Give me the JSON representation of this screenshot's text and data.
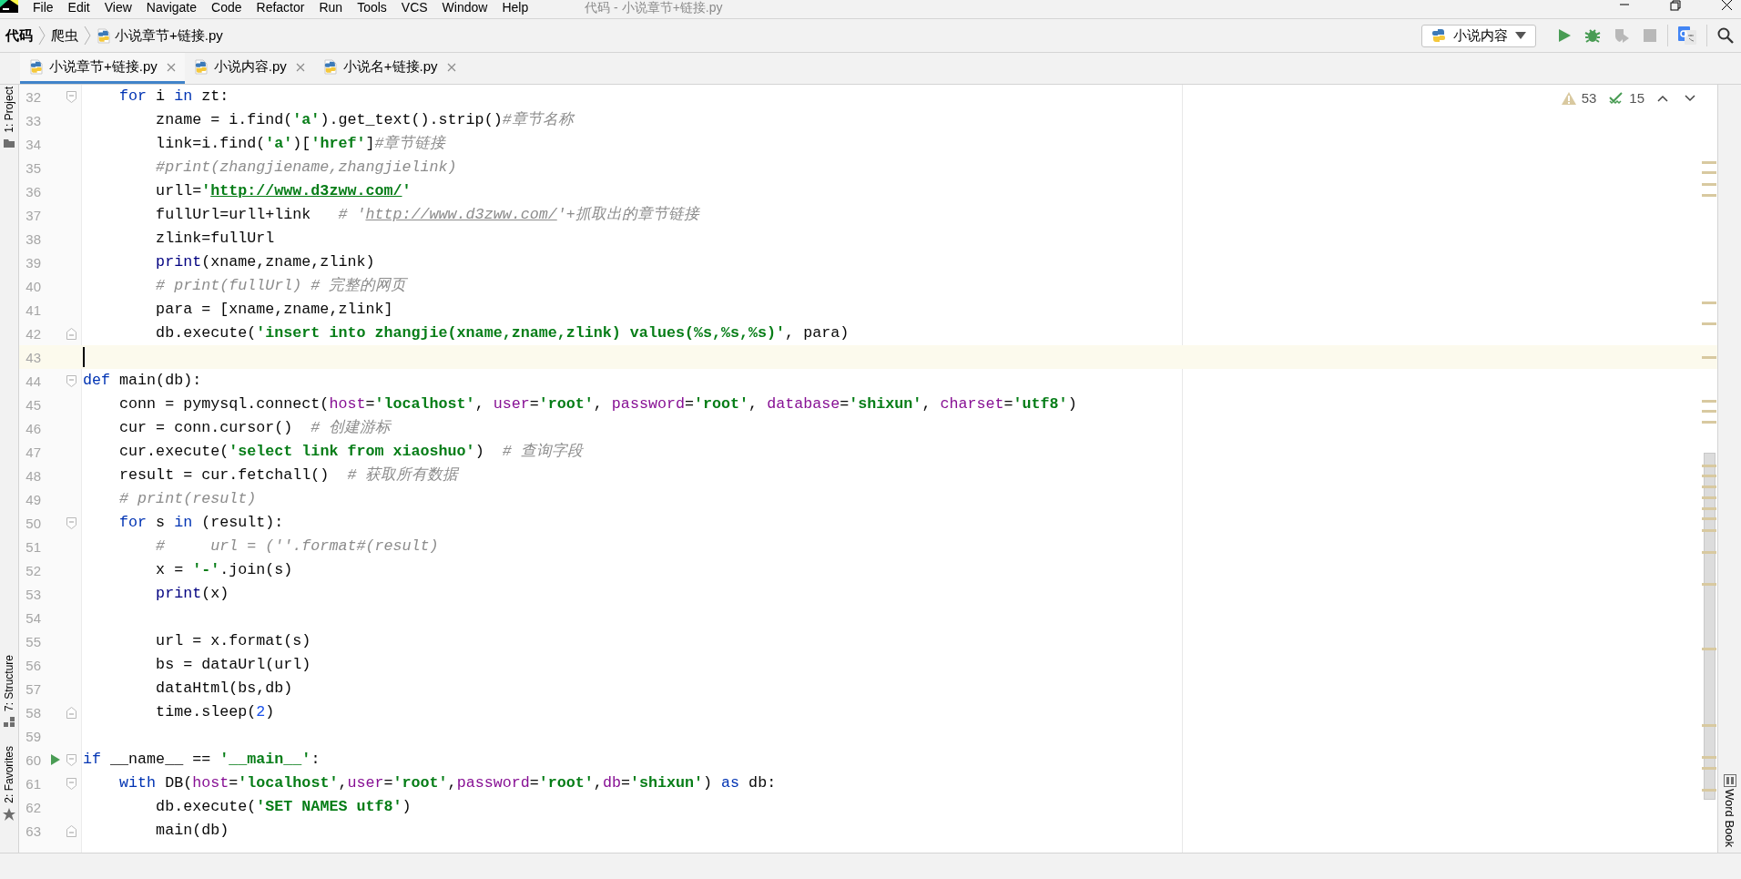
{
  "window": {
    "title": "代码 - 小说章节+链接.py"
  },
  "menu": [
    "File",
    "Edit",
    "View",
    "Navigate",
    "Code",
    "Refactor",
    "Run",
    "Tools",
    "VCS",
    "Window",
    "Help"
  ],
  "breadcrumb": [
    {
      "kind": "project",
      "text": "代码"
    },
    {
      "kind": "folder",
      "text": "爬虫"
    },
    {
      "kind": "file",
      "text": "小说章节+链接.py"
    }
  ],
  "run_config": {
    "label": "小说内容"
  },
  "toolbar": [
    {
      "kind": "run",
      "disabled": false
    },
    {
      "kind": "debug",
      "disabled": false
    },
    {
      "kind": "coverage",
      "disabled": true
    },
    {
      "kind": "stop",
      "disabled": true
    },
    {
      "kind": "translate",
      "disabled": false
    },
    {
      "kind": "search",
      "disabled": false
    }
  ],
  "tabs": [
    {
      "label": "小说章节+链接.py",
      "selected": true
    },
    {
      "label": "小说内容.py",
      "selected": false
    },
    {
      "label": "小说名+链接.py",
      "selected": false
    }
  ],
  "left_tools": [
    {
      "kind": "project",
      "label": "1: Project"
    },
    {
      "kind": "structure",
      "label": "7: Structure"
    },
    {
      "kind": "favorites",
      "label": "2: Favorites"
    }
  ],
  "right_tools": [
    {
      "label": "Word Book"
    }
  ],
  "inspections": {
    "warnings": "53",
    "typos": "15"
  },
  "lines": [
    {
      "n": "32",
      "fold_start": true,
      "fold_end": false,
      "run": false,
      "current": false,
      "tokens": [
        {
          "kind": "keyword",
          "text": "    for"
        },
        {
          "kind": "plain",
          "text": " i "
        },
        {
          "kind": "keyword",
          "text": "in"
        },
        {
          "kind": "plain",
          "text": " zt:"
        }
      ]
    },
    {
      "n": "33",
      "fold_start": false,
      "fold_end": false,
      "run": false,
      "current": false,
      "tokens": [
        {
          "kind": "plain",
          "text": "        zname = i.find("
        },
        {
          "kind": "string",
          "text": "'a'"
        },
        {
          "kind": "plain",
          "text": ").get_text().strip()"
        },
        {
          "kind": "comment",
          "text": "#章节名称"
        }
      ]
    },
    {
      "n": "34",
      "fold_start": false,
      "fold_end": false,
      "run": false,
      "current": false,
      "tokens": [
        {
          "kind": "plain",
          "text": "        link=i.find("
        },
        {
          "kind": "string",
          "text": "'a'"
        },
        {
          "kind": "plain",
          "text": ")["
        },
        {
          "kind": "string",
          "text": "'href'"
        },
        {
          "kind": "plain",
          "text": "]"
        },
        {
          "kind": "comment",
          "text": "#章节链接"
        }
      ]
    },
    {
      "n": "35",
      "fold_start": false,
      "fold_end": false,
      "run": false,
      "current": false,
      "tokens": [
        {
          "kind": "comment",
          "text": "        #print(zhangjiename,zhangjielink)"
        }
      ]
    },
    {
      "n": "36",
      "fold_start": false,
      "fold_end": false,
      "run": false,
      "current": false,
      "tokens": [
        {
          "kind": "plain",
          "text": "        urll="
        },
        {
          "kind": "string",
          "text": "'"
        },
        {
          "kind": "link",
          "text": "http://www.d3zww.com/"
        },
        {
          "kind": "string",
          "text": "'"
        }
      ]
    },
    {
      "n": "37",
      "fold_start": false,
      "fold_end": false,
      "run": false,
      "current": false,
      "tokens": [
        {
          "kind": "plain",
          "text": "        fullUrl=urll+link   "
        },
        {
          "kind": "comment",
          "text": "# '"
        },
        {
          "kind": "comment_link",
          "text": "http://www.d3zww.com/"
        },
        {
          "kind": "comment",
          "text": "'+抓取出的章节链接"
        }
      ]
    },
    {
      "n": "38",
      "fold_start": false,
      "fold_end": false,
      "run": false,
      "current": false,
      "tokens": [
        {
          "kind": "plain",
          "text": "        zlink=fullUrl"
        }
      ]
    },
    {
      "n": "39",
      "fold_start": false,
      "fold_end": false,
      "run": false,
      "current": false,
      "tokens": [
        {
          "kind": "builtin",
          "text": "        print"
        },
        {
          "kind": "plain",
          "text": "(xname,zname,zlink)"
        }
      ]
    },
    {
      "n": "40",
      "fold_start": false,
      "fold_end": false,
      "run": false,
      "current": false,
      "tokens": [
        {
          "kind": "comment",
          "text": "        # print(fullUrl) # 完整的网页"
        }
      ]
    },
    {
      "n": "41",
      "fold_start": false,
      "fold_end": false,
      "run": false,
      "current": false,
      "tokens": [
        {
          "kind": "plain",
          "text": "        para = [xname,zname,zlink]"
        }
      ]
    },
    {
      "n": "42",
      "fold_start": false,
      "fold_end": true,
      "run": false,
      "current": false,
      "tokens": [
        {
          "kind": "plain",
          "text": "        db.execute("
        },
        {
          "kind": "string",
          "text": "'insert into zhangjie(xname,zname,zlink) values(%s,%s,%s)'"
        },
        {
          "kind": "plain",
          "text": ", para)"
        }
      ]
    },
    {
      "n": "43",
      "fold_start": false,
      "fold_end": false,
      "run": false,
      "current": true
    },
    {
      "n": "44",
      "fold_start": true,
      "fold_end": false,
      "run": false,
      "current": false,
      "tokens": [
        {
          "kind": "keyword",
          "text": "def"
        },
        {
          "kind": "plain",
          "text": " main(db):"
        }
      ]
    },
    {
      "n": "45",
      "fold_start": false,
      "fold_end": false,
      "run": false,
      "current": false,
      "tokens": [
        {
          "kind": "plain",
          "text": "    conn = pymysql.connect("
        },
        {
          "kind": "param",
          "text": "host"
        },
        {
          "kind": "plain",
          "text": "="
        },
        {
          "kind": "string",
          "text": "'localhost'"
        },
        {
          "kind": "plain",
          "text": ", "
        },
        {
          "kind": "param",
          "text": "user"
        },
        {
          "kind": "plain",
          "text": "="
        },
        {
          "kind": "string",
          "text": "'root'"
        },
        {
          "kind": "plain",
          "text": ", "
        },
        {
          "kind": "param",
          "text": "password"
        },
        {
          "kind": "plain",
          "text": "="
        },
        {
          "kind": "string",
          "text": "'root'"
        },
        {
          "kind": "plain",
          "text": ", "
        },
        {
          "kind": "param",
          "text": "database"
        },
        {
          "kind": "plain",
          "text": "="
        },
        {
          "kind": "string",
          "text": "'shixun'"
        },
        {
          "kind": "plain",
          "text": ", "
        },
        {
          "kind": "param",
          "text": "charset"
        },
        {
          "kind": "plain",
          "text": "="
        },
        {
          "kind": "string",
          "text": "'utf8'"
        },
        {
          "kind": "plain",
          "text": ")"
        }
      ]
    },
    {
      "n": "46",
      "fold_start": false,
      "fold_end": false,
      "run": false,
      "current": false,
      "tokens": [
        {
          "kind": "plain",
          "text": "    cur = conn.cursor()  "
        },
        {
          "kind": "comment",
          "text": "# 创建游标"
        }
      ]
    },
    {
      "n": "47",
      "fold_start": false,
      "fold_end": false,
      "run": false,
      "current": false,
      "tokens": [
        {
          "kind": "plain",
          "text": "    cur.execute("
        },
        {
          "kind": "string",
          "text": "'select link from xiaoshuo'"
        },
        {
          "kind": "plain",
          "text": ")  "
        },
        {
          "kind": "comment",
          "text": "# 查询字段"
        }
      ]
    },
    {
      "n": "48",
      "fold_start": false,
      "fold_end": false,
      "run": false,
      "current": false,
      "tokens": [
        {
          "kind": "plain",
          "text": "    result = cur.fetchall()  "
        },
        {
          "kind": "comment",
          "text": "# 获取所有数据"
        }
      ]
    },
    {
      "n": "49",
      "fold_start": false,
      "fold_end": false,
      "run": false,
      "current": false,
      "tokens": [
        {
          "kind": "comment",
          "text": "    # print(result)"
        }
      ]
    },
    {
      "n": "50",
      "fold_start": true,
      "fold_end": false,
      "run": false,
      "current": false,
      "tokens": [
        {
          "kind": "keyword",
          "text": "    for"
        },
        {
          "kind": "plain",
          "text": " s "
        },
        {
          "kind": "keyword",
          "text": "in"
        },
        {
          "kind": "plain",
          "text": " (result):"
        }
      ]
    },
    {
      "n": "51",
      "fold_start": false,
      "fold_end": false,
      "run": false,
      "current": false,
      "tokens": [
        {
          "kind": "comment",
          "text": "        #     url = (''.format#(result)"
        }
      ]
    },
    {
      "n": "52",
      "fold_start": false,
      "fold_end": false,
      "run": false,
      "current": false,
      "tokens": [
        {
          "kind": "plain",
          "text": "        x = "
        },
        {
          "kind": "string",
          "text": "'-'"
        },
        {
          "kind": "plain",
          "text": ".join(s)"
        }
      ]
    },
    {
      "n": "53",
      "fold_start": false,
      "fold_end": false,
      "run": false,
      "current": false,
      "tokens": [
        {
          "kind": "builtin",
          "text": "        print"
        },
        {
          "kind": "plain",
          "text": "(x)"
        }
      ]
    },
    {
      "n": "54",
      "fold_start": false,
      "fold_end": false,
      "run": false,
      "current": false
    },
    {
      "n": "55",
      "fold_start": false,
      "fold_end": false,
      "run": false,
      "current": false,
      "tokens": [
        {
          "kind": "plain",
          "text": "        url = x.format(s)"
        }
      ]
    },
    {
      "n": "56",
      "fold_start": false,
      "fold_end": false,
      "run": false,
      "current": false,
      "tokens": [
        {
          "kind": "plain",
          "text": "        bs = dataUrl(url)"
        }
      ]
    },
    {
      "n": "57",
      "fold_start": false,
      "fold_end": false,
      "run": false,
      "current": false,
      "tokens": [
        {
          "kind": "plain",
          "text": "        dataHtml(bs,db)"
        }
      ]
    },
    {
      "n": "58",
      "fold_start": false,
      "fold_end": true,
      "run": false,
      "current": false,
      "tokens": [
        {
          "kind": "plain",
          "text": "        time.sleep("
        },
        {
          "kind": "number",
          "text": "2"
        },
        {
          "kind": "plain",
          "text": ")"
        }
      ]
    },
    {
      "n": "59",
      "fold_start": false,
      "fold_end": false,
      "run": false,
      "current": false
    },
    {
      "n": "60",
      "fold_start": true,
      "fold_end": false,
      "run": true,
      "current": false,
      "tokens": [
        {
          "kind": "keyword",
          "text": "if"
        },
        {
          "kind": "plain",
          "text": " __name__ == "
        },
        {
          "kind": "string",
          "text": "'__main__'"
        },
        {
          "kind": "plain",
          "text": ":"
        }
      ]
    },
    {
      "n": "61",
      "fold_start": true,
      "fold_end": false,
      "run": false,
      "current": false,
      "tokens": [
        {
          "kind": "keyword",
          "text": "    with"
        },
        {
          "kind": "plain",
          "text": " DB("
        },
        {
          "kind": "param",
          "text": "host"
        },
        {
          "kind": "plain",
          "text": "="
        },
        {
          "kind": "string",
          "text": "'localhost'"
        },
        {
          "kind": "plain",
          "text": ","
        },
        {
          "kind": "param",
          "text": "user"
        },
        {
          "kind": "plain",
          "text": "="
        },
        {
          "kind": "string",
          "text": "'root'"
        },
        {
          "kind": "plain",
          "text": ","
        },
        {
          "kind": "param",
          "text": "password"
        },
        {
          "kind": "plain",
          "text": "="
        },
        {
          "kind": "string",
          "text": "'root'"
        },
        {
          "kind": "plain",
          "text": ","
        },
        {
          "kind": "param",
          "text": "db"
        },
        {
          "kind": "plain",
          "text": "="
        },
        {
          "kind": "string",
          "text": "'shixun'"
        },
        {
          "kind": "plain",
          "text": ") "
        },
        {
          "kind": "keyword",
          "text": "as"
        },
        {
          "kind": "plain",
          "text": " db:"
        }
      ]
    },
    {
      "n": "62",
      "fold_start": false,
      "fold_end": false,
      "run": false,
      "current": false,
      "tokens": [
        {
          "kind": "plain",
          "text": "        db.execute("
        },
        {
          "kind": "string",
          "text": "'SET NAMES utf8'"
        },
        {
          "kind": "plain",
          "text": ")"
        }
      ]
    },
    {
      "n": "63",
      "fold_start": false,
      "fold_end": true,
      "run": false,
      "current": false,
      "tokens": [
        {
          "kind": "plain",
          "text": "        main(db)"
        }
      ]
    }
  ]
}
